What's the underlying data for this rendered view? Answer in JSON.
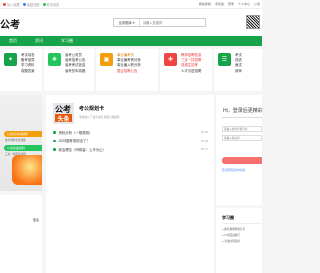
{
  "topbar": {
    "left": [
      "加入收藏",
      "返回顶部",
      "考试动态"
    ],
    "right": [
      "网站导航",
      "手机版",
      "登录",
      "个人中心",
      "公考"
    ]
  },
  "header": {
    "logo": "公考",
    "search": {
      "select": "全部题库",
      "placeholder": "请输入关键词"
    }
  },
  "nav": [
    "首页",
    "资讯",
    "学习圈"
  ],
  "cards": [
    {
      "icon_color": "#16a34a",
      "items": [
        "考试动态",
        "备考指导",
        "学习资料",
        "真题答案"
      ]
    },
    {
      "icon_color": "#22c55e",
      "items": [
        "省考公务员",
        "省考招考公告",
        "省考考试信息",
        "省考历年真题"
      ]
    },
    {
      "icon_color": "#f59e0b",
      "items": [
        "事业编考试",
        "事业编考情分析",
        "事业编入职分析",
        "国企招聘公告"
      ]
    },
    {
      "icon_color": "#ef4444",
      "items": [
        "教师招聘信息",
        "三支一扶招聘",
        "选调生招考",
        "人才引进招聘"
      ]
    },
    {
      "icon_color": "#16a34a",
      "items": [
        "考试",
        "成绩",
        "面试",
        "政审"
      ]
    }
  ],
  "left": {
    "pills": [
      "公务员考试辅导",
      "公考必备资料"
    ],
    "subs": [
      "备考资料免费领取",
      "三支一扶历年真题"
    ],
    "more": "更多"
  },
  "main": {
    "badge_top": "公考",
    "badge_bottom": "头条",
    "title": "考公规划卡",
    "subtitle": "零基础入门 备考指南 重要日期提醒",
    "list": [
      {
        "text": "资料分析（一般原则）",
        "date": "05-28"
      },
      {
        "text": "2025国考成绩出了！",
        "date": "05-28"
      },
      {
        "text": "政治理论（吗啡量：上半为止）",
        "date": "05-27"
      }
    ]
  },
  "login": {
    "title": "Hi，登录后更精彩",
    "field1": "请输入您的手机号码",
    "field2": "请输入验证码",
    "link": "登录即同意用户协议"
  },
  "study": {
    "heading": "学习圈",
    "items": [
      "备考规划经验分享",
      "公考面试技巧",
      "考试时间安排"
    ]
  }
}
